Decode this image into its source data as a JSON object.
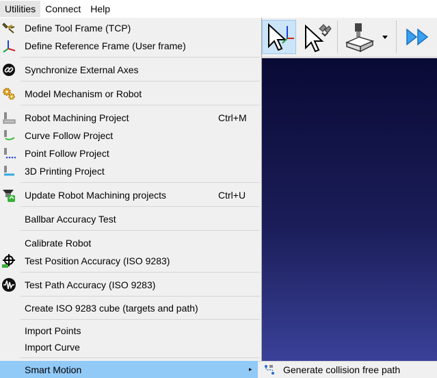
{
  "menubar": {
    "items": [
      {
        "label": "Utilities"
      },
      {
        "label": "Connect"
      },
      {
        "label": "Help"
      }
    ]
  },
  "menu": {
    "items": [
      {
        "label": "Define Tool Frame (TCP)",
        "icon": "tool-frame-icon"
      },
      {
        "label": "Define Reference Frame (User frame)",
        "icon": "reference-frame-icon"
      },
      {
        "label": "Synchronize External Axes",
        "icon": "link-icon"
      },
      {
        "label": "Model Mechanism or Robot",
        "icon": "gears-icon"
      },
      {
        "label": "Robot Machining Project",
        "shortcut": "Ctrl+M",
        "icon": "machining-icon"
      },
      {
        "label": "Curve Follow Project",
        "icon": "curve-follow-icon"
      },
      {
        "label": "Point Follow Project",
        "icon": "point-follow-icon"
      },
      {
        "label": "3D Printing Project",
        "icon": "printing-3d-icon"
      },
      {
        "label": "Update Robot Machining projects",
        "shortcut": "Ctrl+U",
        "icon": "update-machining-icon"
      },
      {
        "label": "Ballbar Accuracy Test"
      },
      {
        "label": "Calibrate Robot"
      },
      {
        "label": "Test Position Accuracy (ISO 9283)",
        "icon": "target-icon"
      },
      {
        "label": "Test Path Accuracy (ISO 9283)",
        "icon": "waveform-icon"
      },
      {
        "label": "Create ISO 9283 cube (targets and path)"
      },
      {
        "label": "Import Points"
      },
      {
        "label": "Import Curve"
      },
      {
        "label": "Smart Motion",
        "submenu_arrow": "▸"
      }
    ]
  },
  "submenu": {
    "items": [
      {
        "label": "Generate collision free path",
        "icon": "collision-path-icon"
      }
    ]
  },
  "colors": {
    "highlight": "#91c9f7",
    "menu_bg": "#f0f0f0",
    "viewport_top": "#0a0a35",
    "viewport_bottom": "#3a4198",
    "toolbar_selected": "#cce4f7"
  }
}
